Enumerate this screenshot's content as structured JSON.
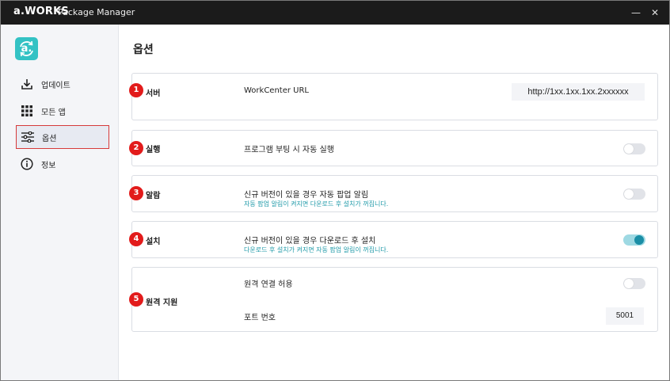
{
  "titlebar": {
    "brand": "a.WORKS",
    "app_name": "Package Manager",
    "minimize_glyph": "—",
    "close_glyph": "✕"
  },
  "sidebar": {
    "logo_letter": "a.",
    "items": [
      {
        "label": "업데이트",
        "icon": "download-icon"
      },
      {
        "label": "모든 앱",
        "icon": "grid-icon"
      },
      {
        "label": "옵션",
        "icon": "sliders-icon",
        "active": true
      },
      {
        "label": "정보",
        "icon": "info-icon"
      }
    ]
  },
  "main": {
    "title": "옵션",
    "sections": {
      "server": {
        "badge": "1",
        "label": "서버",
        "option": "WorkCenter URL",
        "url_value": "http://1xx.1xx.1xx.2xxxxxx"
      },
      "run": {
        "badge": "2",
        "label": "실행",
        "option": "프로그램 부팅 시 자동 실행",
        "enabled": false
      },
      "alarm": {
        "badge": "3",
        "label": "알람",
        "option": "신규 버전이 있을 경우 자동 팝업 알림",
        "sub": "자동 팝업 알림이 켜지면 다운로드 후 설치가 꺼집니다.",
        "enabled": false
      },
      "install": {
        "badge": "4",
        "label": "설치",
        "option": "신규 버전이 있을 경우 다운로드 후 설치",
        "sub": "다운로드 후 설치가 켜지면 자동 팝업 알림이 꺼집니다.",
        "enabled": true
      },
      "remote": {
        "badge": "5",
        "label": "원격 지원",
        "allow_option": "원격 연결 허용",
        "allow_enabled": false,
        "port_label": "포트 번호",
        "port_value": "5001"
      }
    }
  },
  "colors": {
    "titlebar_bg": "#1b1b1b",
    "accent": "#1a8ea6",
    "badge": "#e21b1b",
    "logo": "#33c2c4",
    "active_border": "#d63a3a"
  }
}
